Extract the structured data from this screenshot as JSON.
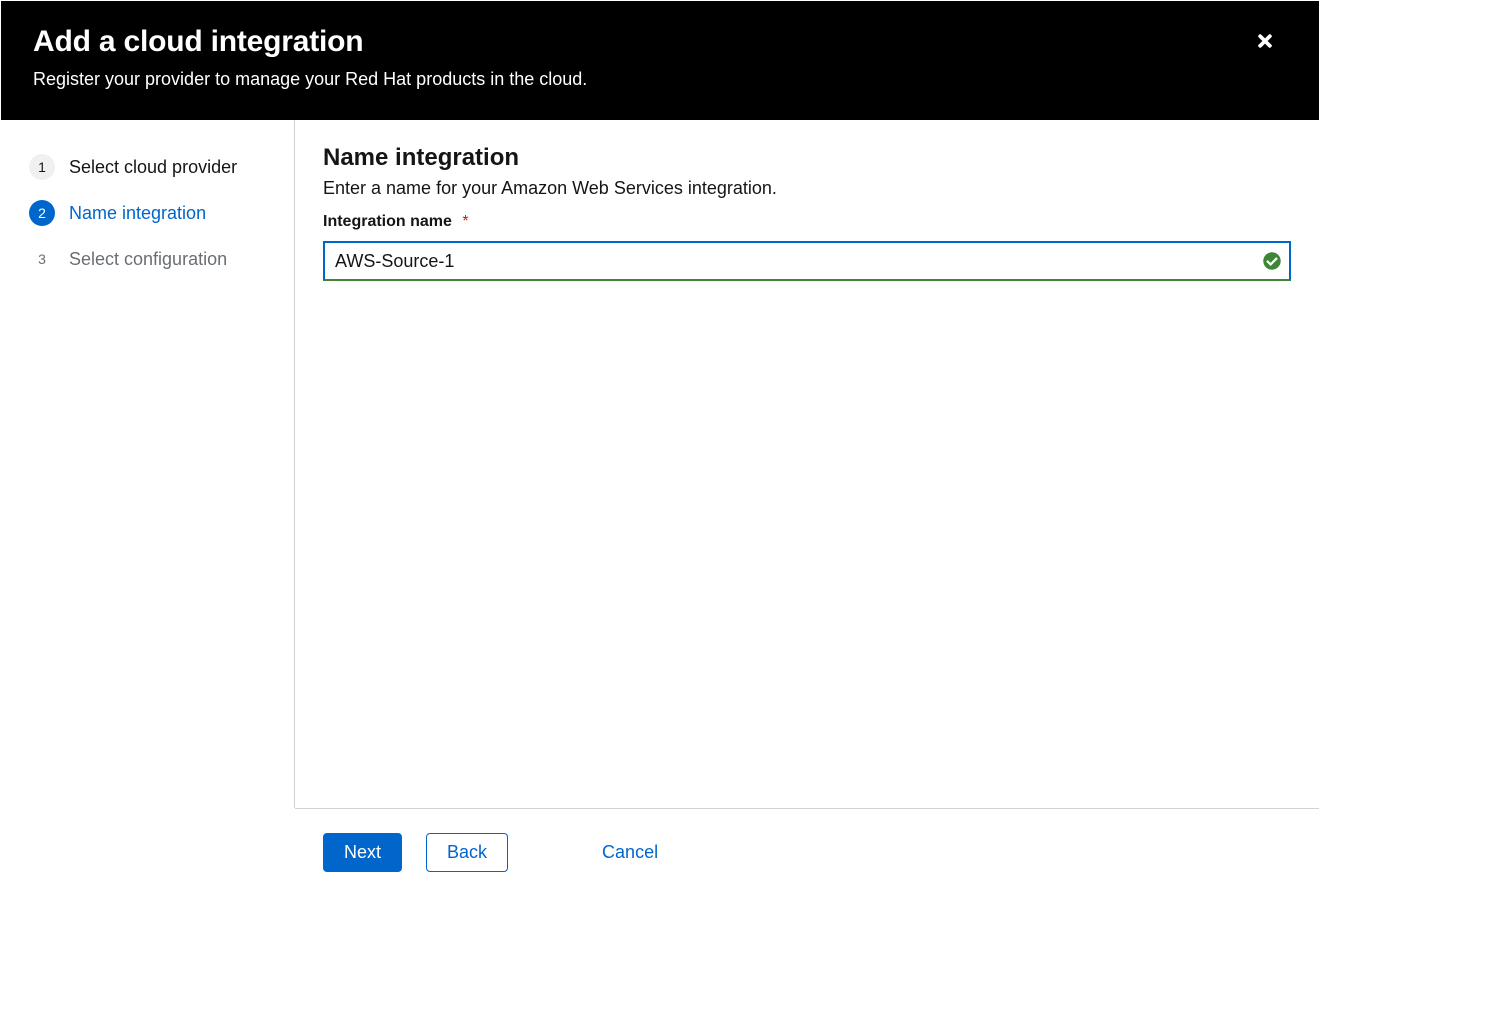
{
  "header": {
    "title": "Add a cloud integration",
    "description": "Register your provider to manage your Red Hat products in the cloud."
  },
  "wizard": {
    "steps": [
      {
        "num": "1",
        "label": "Select cloud provider",
        "state": "done"
      },
      {
        "num": "2",
        "label": "Name integration",
        "state": "active"
      },
      {
        "num": "3",
        "label": "Select configuration",
        "state": "pending"
      }
    ]
  },
  "page": {
    "heading": "Name integration",
    "subheading": "Enter a name for your Amazon Web Services integration.",
    "field_label": "Integration name",
    "required_marker": "*",
    "input_value": "AWS-Source-1"
  },
  "footer": {
    "next": "Next",
    "back": "Back",
    "cancel": "Cancel"
  }
}
